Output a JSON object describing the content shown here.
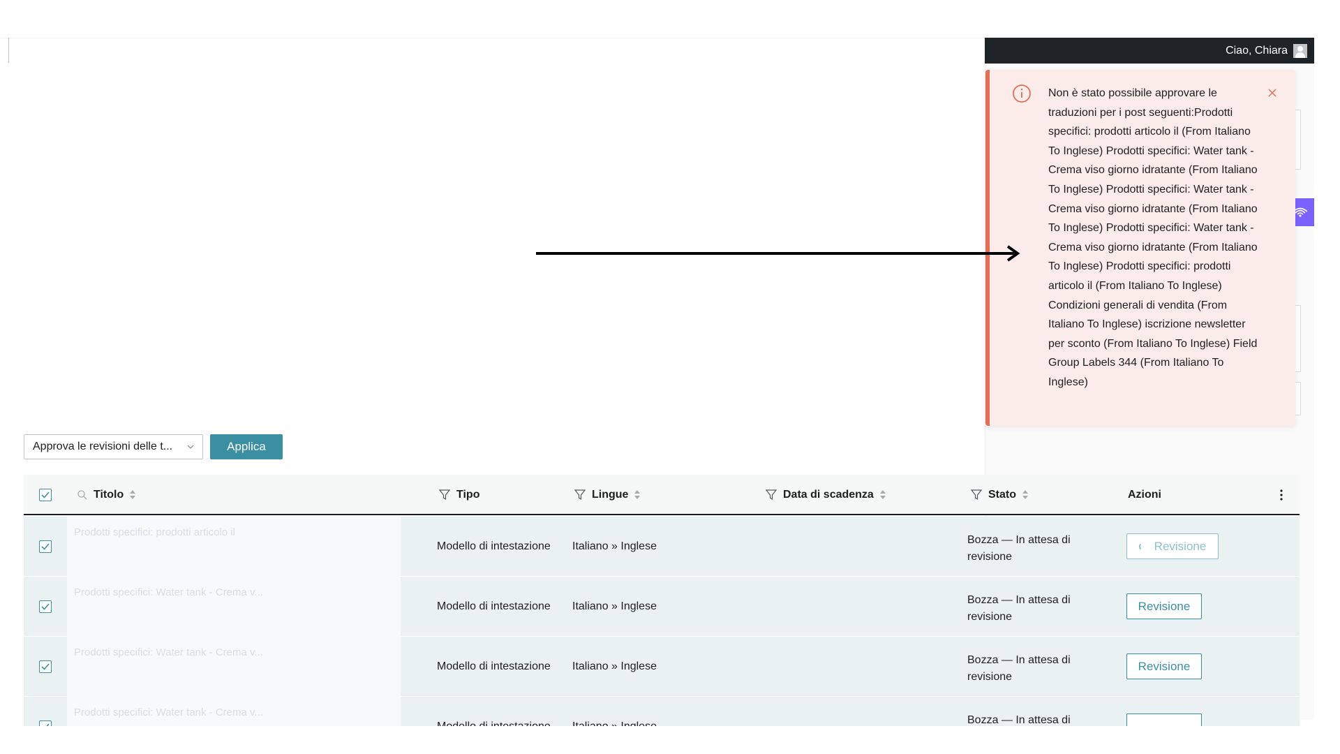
{
  "adminbar": {
    "greeting": "Ciao, Chiara"
  },
  "notice": {
    "message": "Non è stato possibile approvare le traduzioni per i post seguenti:Prodotti specifici: prodotti articolo il (From Italiano To Inglese) Prodotti specifici: Water tank - Crema viso giorno idratante (From Italiano To Inglese) Prodotti specifici: Water tank - Crema viso giorno idratante (From Italiano To Inglese) Prodotti specifici: Water tank - Crema viso giorno idratante (From Italiano To Inglese) Prodotti specifici: prodotti articolo il (From Italiano To Inglese) Condizioni generali di vendita (From Italiano To Inglese) iscrizione newsletter per sconto (From Italiano To Inglese) Field Group Labels 344 (From Italiano To Inglese)",
    "icon": "info-circle-icon",
    "accent_color": "#e26f56",
    "background_color": "#fcece9"
  },
  "bulk_actions": {
    "selected": "Approva le revisioni delle t...",
    "apply_label": "Applica"
  },
  "table": {
    "columns": {
      "titolo": "Titolo",
      "tipo": "Tipo",
      "lingue": "Lingue",
      "data": "Data di scadenza",
      "stato": "Stato",
      "azioni": "Azioni"
    },
    "rows": [
      {
        "title": "Prodotti specifici: prodotti articolo il",
        "tipo": "Modello di intestazione",
        "lingue": "Italiano » Inglese",
        "stato": "Bozza — In attesa di revisione",
        "action": "Revisione",
        "loading": true
      },
      {
        "title": "Prodotti specifici: Water tank - Crema v...",
        "tipo": "Modello di intestazione",
        "lingue": "Italiano » Inglese",
        "stato": "Bozza — In attesa di revisione",
        "action": "Revisione",
        "loading": false
      },
      {
        "title": "Prodotti specifici: Water tank - Crema v...",
        "tipo": "Modello di intestazione",
        "lingue": "Italiano » Inglese",
        "stato": "Bozza — In attesa di revisione",
        "action": "Revisione",
        "loading": false
      },
      {
        "title": "Prodotti specifici: Water tank - Crema v...",
        "tipo": "Modello di intestazione",
        "lingue": "Italiano » Inglese",
        "stato": "Bozza — In attesa di",
        "action": "",
        "loading": false
      }
    ]
  },
  "colors": {
    "primary": "#3b8fa3",
    "adminbar": "#1d2327",
    "row_bg": "#e9f1f3"
  }
}
